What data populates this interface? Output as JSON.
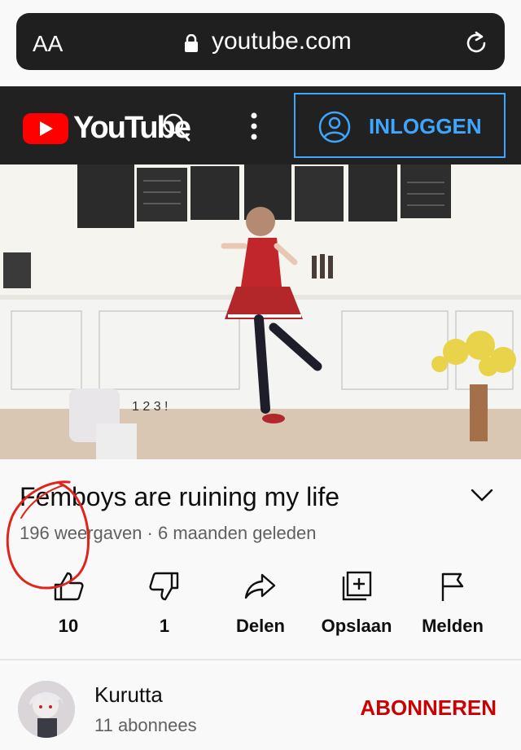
{
  "browser": {
    "text_size_label": "AA",
    "url": "youtube.com"
  },
  "header": {
    "logo_text": "YouTube",
    "signin_label": "INLOGGEN"
  },
  "video": {
    "overlay_text": "1 2 3 !"
  },
  "info": {
    "title": "Femboys are ruining my life",
    "meta": "196 weergaven · 6 maanden geleden"
  },
  "actions": [
    {
      "label": "10",
      "icon": "thumbs-up-icon"
    },
    {
      "label": "1",
      "icon": "thumbs-down-icon"
    },
    {
      "label": "Delen",
      "icon": "share-icon"
    },
    {
      "label": "Opslaan",
      "icon": "add-to-playlist-icon"
    },
    {
      "label": "Melden",
      "icon": "flag-icon"
    }
  ],
  "channel": {
    "name": "Kurutta",
    "subscribers": "11 abonnees",
    "subscribe_label": "ABONNEREN"
  },
  "colors": {
    "brand_red": "#ff0000",
    "link_blue": "#3ea6ff",
    "subscribe_red": "#cc0000",
    "annotation_red": "#e0241b"
  }
}
